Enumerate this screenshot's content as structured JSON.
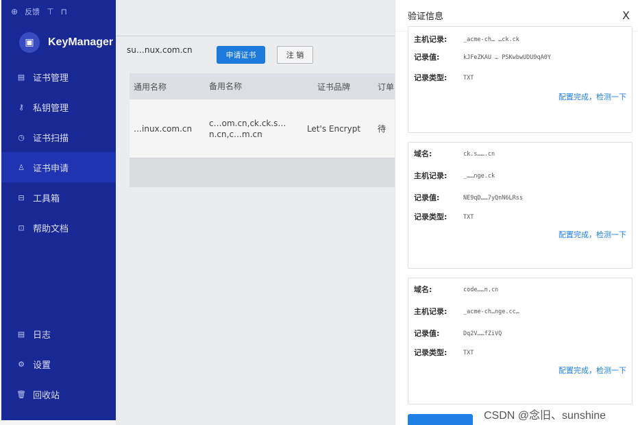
{
  "sidebar": {
    "top_links": [
      "反馈"
    ],
    "brand": "KeyManager",
    "items": [
      {
        "icon": "file-icon",
        "glyph": "▤",
        "label": "证书管理"
      },
      {
        "icon": "key-icon",
        "glyph": "⚷",
        "label": "私钥管理"
      },
      {
        "icon": "scan-icon",
        "glyph": "◷",
        "label": "证书扫描"
      },
      {
        "icon": "user-icon",
        "glyph": "♙",
        "label": "证书申请"
      },
      {
        "icon": "toolbox-icon",
        "glyph": "⊟",
        "label": "工具箱"
      },
      {
        "icon": "document-icon",
        "glyph": "⊡",
        "label": "帮助文档"
      }
    ],
    "bottom_items": [
      {
        "icon": "log-icon",
        "glyph": "▤",
        "label": "日志"
      },
      {
        "icon": "settings-icon",
        "glyph": "⚙",
        "label": "设置"
      },
      {
        "icon": "trash-icon",
        "glyph": "🗑",
        "label": "回收站"
      }
    ]
  },
  "main": {
    "domain_value": "su…nux.com.cn",
    "apply_button": "申请证书",
    "logout_button": "注 销",
    "table": {
      "headers": [
        "通用名称",
        "备用名称",
        "证书品牌",
        "订单"
      ],
      "row": {
        "common_name": "…inux.com.cn",
        "alt_names": "c…om.cn,ck.ck.s…n.cn,c…m.cn",
        "brand": "Let's Encrypt",
        "status": "待"
      }
    }
  },
  "drawer": {
    "title": "验证信息",
    "close": "X",
    "labels": {
      "domain": "域名:",
      "host": "主机记录:",
      "value": "记录值:",
      "type": "记录类型:"
    },
    "action_link": "配置完成，检测一下",
    "cards": [
      {
        "domain": "",
        "host": "_acme-ch… …ck.ck",
        "value": "kJFeZKAU … PSKwbwUDU9qA0Y",
        "type": "TXT"
      },
      {
        "domain": "ck.s…….cn",
        "host": "_……nge.ck",
        "value": "NE9qD……7yQnN6LRss",
        "type": "TXT"
      },
      {
        "domain": "code……n.cn",
        "host": "_acme-ch…nge.cc…",
        "value": "Dq2V……fZiVQ",
        "type": "TXT"
      }
    ]
  },
  "watermark": "CSDN @念旧、sunshine"
}
